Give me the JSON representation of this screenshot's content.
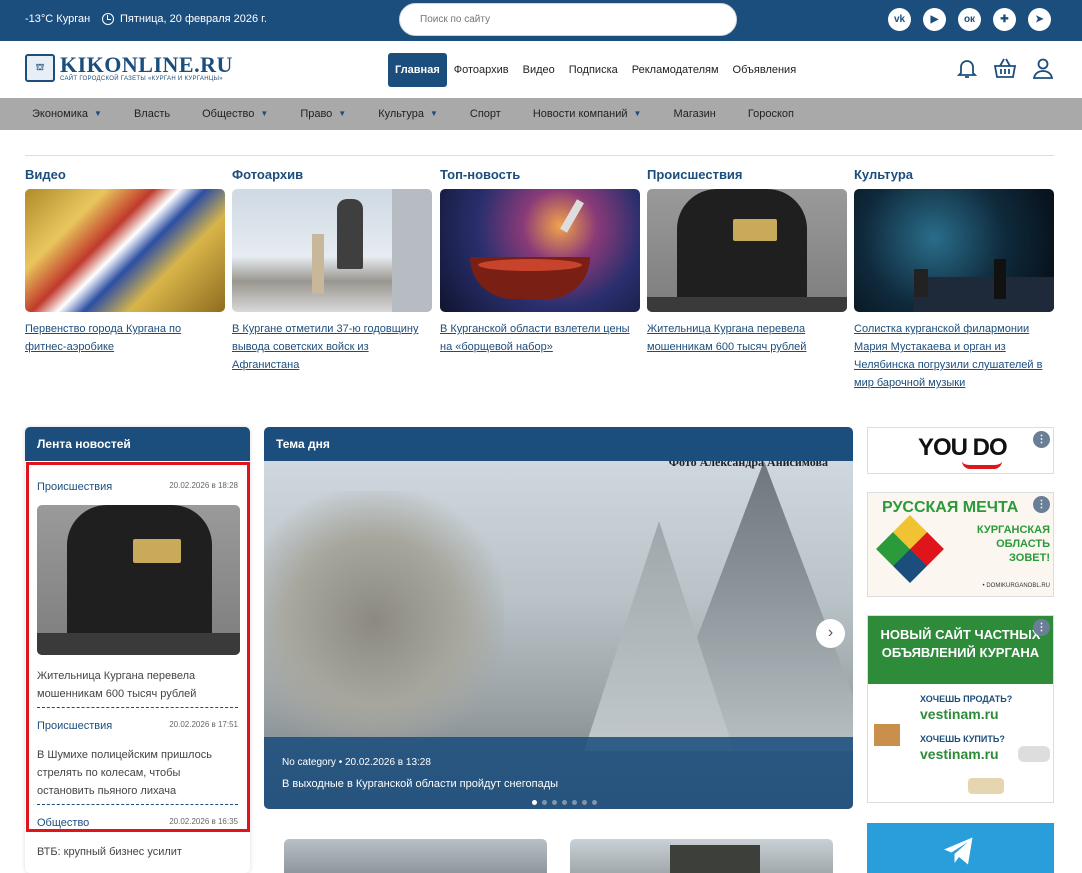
{
  "topbar": {
    "weather": "-13°C  Курган",
    "date": "Пятница, 20 февраля 2026 г.",
    "search_placeholder": "Поиск по сайту",
    "socials": [
      "vk-icon",
      "youtube-icon",
      "odnoklassniki-icon",
      "rutube-icon",
      "telegram-icon"
    ]
  },
  "header": {
    "logo_title": "KIKONLINE.RU",
    "logo_subtitle": "САЙТ ГОРОДСКОЙ ГАЗЕТЫ «КУРГАН И КУРГАНЦЫ»",
    "nav": [
      "Главная",
      "Фотоархив",
      "Видео",
      "Подписка",
      "Рекламодателям",
      "Объявления"
    ]
  },
  "categories": [
    {
      "label": "Экономика",
      "dropdown": true
    },
    {
      "label": "Власть",
      "dropdown": false
    },
    {
      "label": "Общество",
      "dropdown": true
    },
    {
      "label": "Право",
      "dropdown": true
    },
    {
      "label": "Культура",
      "dropdown": true
    },
    {
      "label": "Спорт",
      "dropdown": false
    },
    {
      "label": "Новости компаний",
      "dropdown": true
    },
    {
      "label": "Магазин",
      "dropdown": false
    },
    {
      "label": "Гороскоп",
      "dropdown": false
    }
  ],
  "featured": [
    {
      "section": "Видео",
      "title": "Первенство города Кургана по фитнес-аэробике"
    },
    {
      "section": "Фотоархив",
      "title": "В Кургане отметили 37-ю годовщину вывода советских войск из Афганистана"
    },
    {
      "section": "Топ-новость",
      "title": "В Курганской области взлетели цены на «борщевой набор»"
    },
    {
      "section": "Происшествия",
      "title": "Жительница Кургана перевела мошенникам 600 тысяч рублей"
    },
    {
      "section": "Культура",
      "title": "Солистка курганской филармонии Мария Мустакаева и орган из Челябинска погрузили слушателей в мир барочной музыки"
    }
  ],
  "feed": {
    "title": "Лента новостей",
    "items": [
      {
        "category": "Происшествия",
        "datetime": "20.02.2026 в 18:28",
        "title": "Жительница Кургана перевела мошенникам 600 тысяч рублей"
      },
      {
        "category": "Происшествия",
        "datetime": "20.02.2026 в 17:51",
        "title": "В Шумихе полицейским пришлось стрелять по колесам, чтобы остановить пьяного лихача"
      },
      {
        "category": "Общество",
        "datetime": "20.02.2026 в 16:35",
        "title": "ВТБ: крупный бизнес усилит"
      }
    ]
  },
  "day": {
    "title": "Тема дня",
    "photo_credit": "Фото Александра Анисимова",
    "meta": "No category • 20.02.2026 в 13:28",
    "headline": "В выходные в Курганской области пройдут снегопады",
    "slides": 7,
    "active_slide": 1
  },
  "ads": {
    "youdo": "YOU DO",
    "dream_title": "РУССКАЯ МЕЧТА",
    "dream_text": "КУРГАНСКАЯ ОБЛАСТЬ ЗОВЕТ!",
    "dream_site": "• DOMIKURGANOBL.RU",
    "vestinam_title": "НОВЫЙ САЙТ ЧАСТНЫХ ОБЪЯВЛЕНИЙ КУРГАНА",
    "sell_q": "ХОЧЕШЬ ПРОДАТЬ?",
    "buy_q": "ХОЧЕШЬ КУПИТЬ?",
    "site": "vestinam.ru"
  },
  "colors": {
    "brand": "#1c4e7d",
    "catbar": "#a9a9a9",
    "highlight": "#e0151c"
  }
}
